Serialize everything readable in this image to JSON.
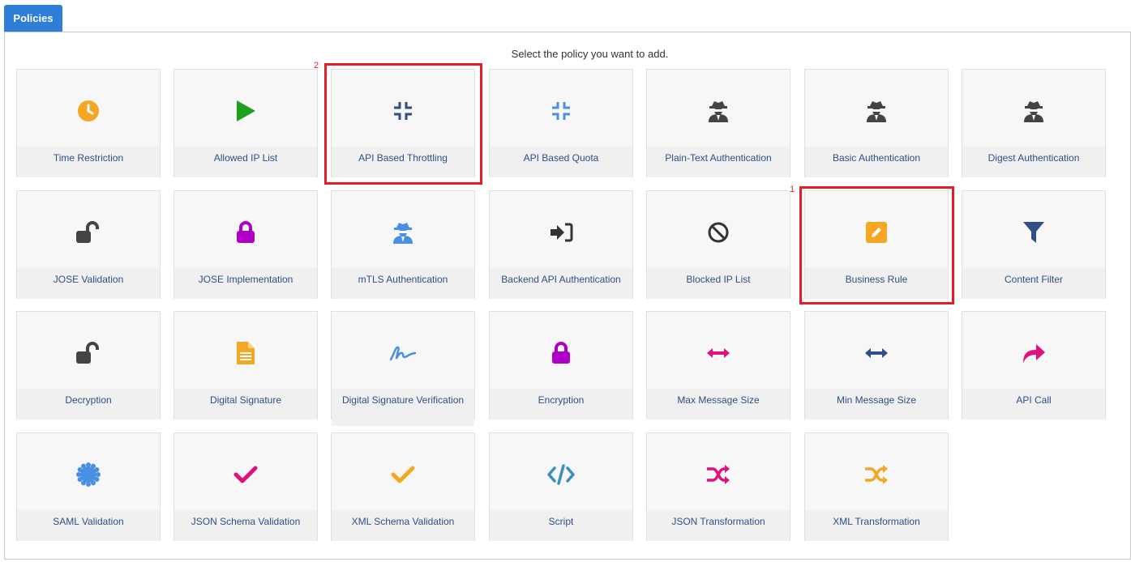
{
  "tabs": {
    "policies": "Policies"
  },
  "instruction": "Select the policy you want to add.",
  "annotations": [
    "1",
    "2"
  ],
  "policies": [
    {
      "label": "Time Restriction",
      "icon": "clock-icon",
      "color": "#f5a623"
    },
    {
      "label": "Allowed IP List",
      "icon": "play-icon",
      "color": "#1ea01e"
    },
    {
      "label": "API Based Throttling",
      "icon": "compress-icon",
      "color": "#2f4f86"
    },
    {
      "label": "API Based Quota",
      "icon": "compress-icon",
      "color": "#4a90e2"
    },
    {
      "label": "Plain-Text Authentication",
      "icon": "user-secret-icon",
      "color": "#444444"
    },
    {
      "label": "Basic Authentication",
      "icon": "user-secret-icon",
      "color": "#444444"
    },
    {
      "label": "Digest Authentication",
      "icon": "user-secret-icon",
      "color": "#444444"
    },
    {
      "label": "JOSE Validation",
      "icon": "unlock-icon",
      "color": "#444444"
    },
    {
      "label": "JOSE Implementation",
      "icon": "lock-icon",
      "color": "#b000c8"
    },
    {
      "label": "mTLS Authentication",
      "icon": "user-secret-icon",
      "color": "#4a90e2"
    },
    {
      "label": "Backend API Authentication",
      "icon": "sign-in-icon",
      "color": "#333333"
    },
    {
      "label": "Blocked IP List",
      "icon": "ban-icon",
      "color": "#333333"
    },
    {
      "label": "Business Rule",
      "icon": "edit-icon",
      "color": "#f5a623"
    },
    {
      "label": "Content Filter",
      "icon": "filter-icon",
      "color": "#2f4f86"
    },
    {
      "label": "Decryption",
      "icon": "unlock-icon",
      "color": "#444444"
    },
    {
      "label": "Digital Signature",
      "icon": "file-text-icon",
      "color": "#f5a623"
    },
    {
      "label": "Digital Signature Verification",
      "icon": "signature-icon",
      "color": "#4a90e2"
    },
    {
      "label": "Encryption",
      "icon": "lock-icon",
      "color": "#b000c8"
    },
    {
      "label": "Max Message Size",
      "icon": "arrows-h-icon",
      "color": "#e0107e"
    },
    {
      "label": "Min Message Size",
      "icon": "arrows-h-icon",
      "color": "#2f4f86"
    },
    {
      "label": "API Call",
      "icon": "share-icon",
      "color": "#e0107e"
    },
    {
      "label": "SAML Validation",
      "icon": "certificate-icon",
      "color": "#4a90e2"
    },
    {
      "label": "JSON Schema Validation",
      "icon": "check-icon",
      "color": "#e0107e"
    },
    {
      "label": "XML Schema Validation",
      "icon": "check-icon",
      "color": "#f5a623"
    },
    {
      "label": "Script",
      "icon": "code-icon",
      "color": "#3a8fbd"
    },
    {
      "label": "JSON Transformation",
      "icon": "random-icon",
      "color": "#e0107e"
    },
    {
      "label": "XML Transformation",
      "icon": "random-icon",
      "color": "#f5a623"
    }
  ],
  "highlight_color": "#e31e24"
}
